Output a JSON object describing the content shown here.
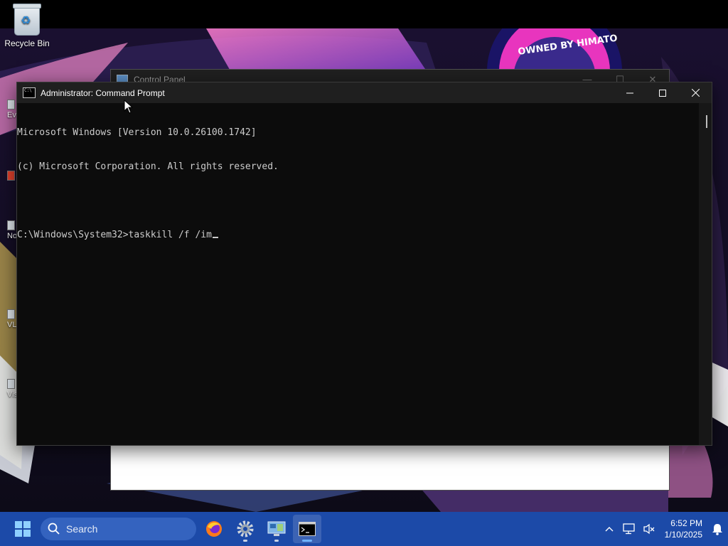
{
  "desktop": {
    "icons": [
      {
        "label": "Recycle Bin"
      }
    ],
    "peek_labels": [
      "Ev",
      "No",
      "VL",
      "Vis"
    ],
    "wallpaper_badge": "OWNED BY HIMATO"
  },
  "control_panel": {
    "title": "Control Panel"
  },
  "cmd": {
    "title": "Administrator: Command Prompt",
    "lines": [
      "Microsoft Windows [Version 10.0.26100.1742]",
      "(c) Microsoft Corporation. All rights reserved.",
      "",
      "C:\\Windows\\System32>taskkill /f /im"
    ],
    "controls": {
      "minimize": "minimize",
      "maximize": "maximize",
      "close": "close"
    }
  },
  "taskbar": {
    "search_label": "Search",
    "apps": [
      "firefox",
      "settings",
      "control-panel",
      "command-prompt"
    ],
    "active_app": "command-prompt",
    "clock": {
      "time": "6:52 PM",
      "date": "1/10/2025"
    }
  },
  "colors": {
    "taskbar_bg": "#1c4aa8",
    "terminal_bg": "#0c0c0c",
    "terminal_fg": "#cccccc",
    "accent": "#6fb3ff"
  }
}
